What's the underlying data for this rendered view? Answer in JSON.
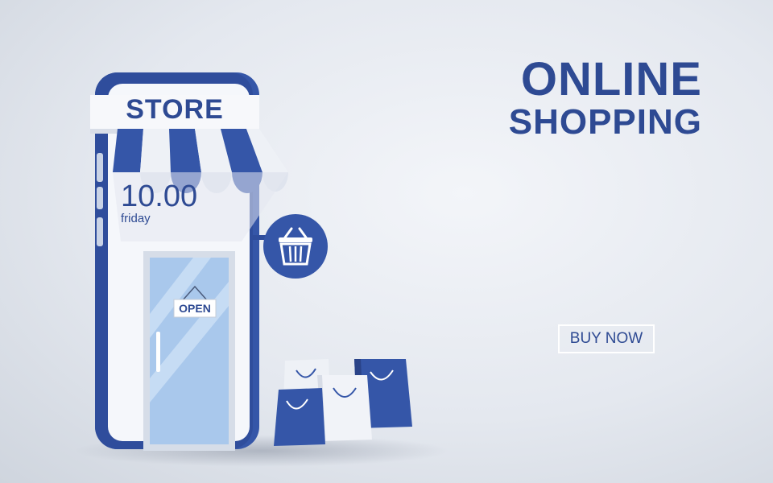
{
  "headline": {
    "line1": "ONLINE",
    "line2": "SHOPPING"
  },
  "cta": {
    "label": "BUY NOW"
  },
  "phone": {
    "store_sign": "STORE",
    "clock_time": "10.00",
    "clock_day": "friday",
    "door_sign": "OPEN"
  },
  "icons": [
    "basket-icon",
    "shopping-bag-icon"
  ],
  "colors": {
    "brand_blue": "#2e4a93",
    "phone_blue": "#3556a8",
    "background": "#e4e8ef",
    "awning_white": "#eef1f6",
    "door_glass": "#a9c8ec"
  }
}
